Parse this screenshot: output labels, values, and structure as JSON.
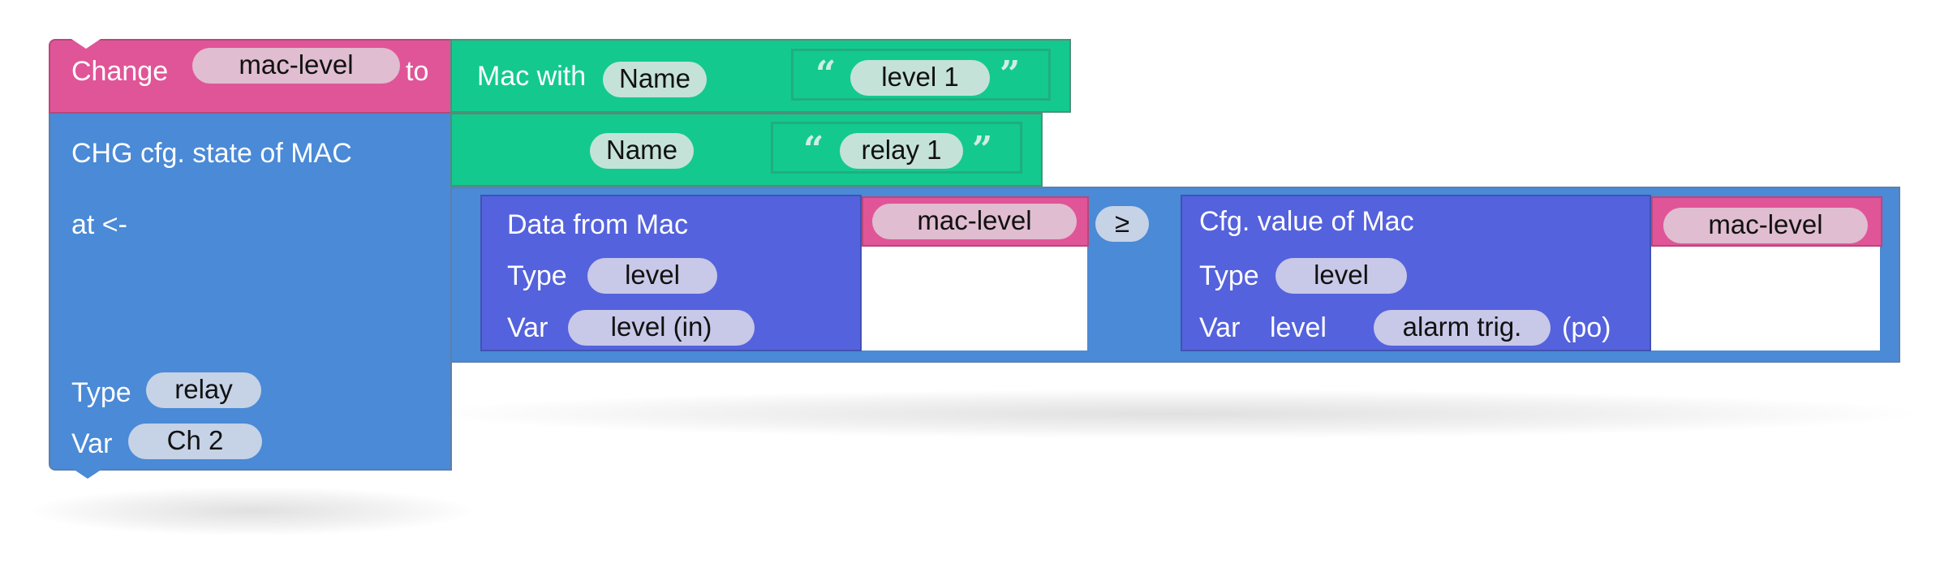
{
  "workspace": {
    "set_block": {
      "label_change": "Change",
      "variable": "mac-level",
      "label_to": "to"
    },
    "mac_with_block": {
      "label": "Mac with",
      "field_name": "Name",
      "open_quote": "“",
      "value": "level 1",
      "close_quote": "”"
    },
    "chg_block": {
      "title": "CHG cfg. state of MAC",
      "field_name": "Name",
      "open_quote": "“",
      "name_value": "relay 1",
      "close_quote": "”",
      "label_at": "at <-",
      "label_type": "Type",
      "type_value": "relay",
      "label_var": "Var",
      "var_value": "Ch 2"
    },
    "data_from_mac_block": {
      "title": "Data from Mac",
      "variable": "mac-level",
      "label_type": "Type",
      "type_value": "level",
      "label_var": "Var",
      "var_value": "level (in)"
    },
    "comparison": {
      "operator": "≥"
    },
    "cfg_value_block": {
      "title": "Cfg. value of Mac",
      "variable": "mac-level",
      "label_type": "Type",
      "type_value": "level",
      "label_var": "Var",
      "var_prefix": "level",
      "var_value": "alarm trig.",
      "var_suffix": "(po)"
    }
  },
  "colors": {
    "variable_block": "#e05597",
    "mac_block": "#14c98e",
    "action_block": "#4a8ad6",
    "data_block": "#5462dd"
  }
}
